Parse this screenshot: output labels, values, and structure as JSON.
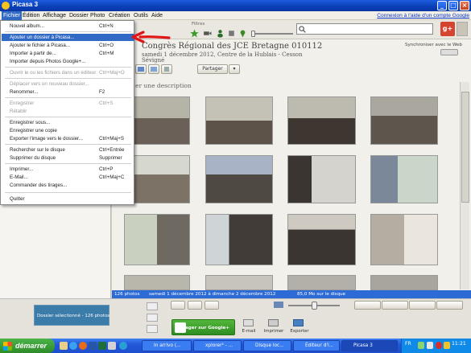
{
  "app": {
    "title": "Picasa 3"
  },
  "menubar": {
    "items": [
      "Fichier",
      "Édition",
      "Affichage",
      "Dossier",
      "Photo",
      "Création",
      "Outils",
      "Aide"
    ],
    "help_link": "Connexion à l'aide d'un compte Google"
  },
  "toolbar": {
    "filters_label": "Filtres",
    "search_value": ""
  },
  "file_menu": {
    "items": [
      {
        "label": "Nouvel album...",
        "shortcut": "Ctrl+N",
        "enabled": true
      },
      {
        "label": "Ajouter un dossier à Picasa...",
        "shortcut": "",
        "enabled": true,
        "highlighted": true
      },
      {
        "label": "Ajouter le fichier à Picasa...",
        "shortcut": "Ctrl+O",
        "enabled": true
      },
      {
        "label": "Importer à partir de...",
        "shortcut": "Ctrl+M",
        "enabled": true
      },
      {
        "label": "Importer depuis Photos Google+...",
        "shortcut": "",
        "enabled": true
      },
      {
        "label": "Ouvrir le ou les fichiers dans un éditeur",
        "shortcut": "Ctrl+Maj+O",
        "enabled": false
      },
      {
        "label": "Déplacer vers un nouveau dossier...",
        "shortcut": "",
        "enabled": false
      },
      {
        "label": "Renommer...",
        "shortcut": "F2",
        "enabled": true
      },
      {
        "label": "Enregistrer",
        "shortcut": "Ctrl+S",
        "enabled": false
      },
      {
        "label": "Rétablir",
        "shortcut": "",
        "enabled": false
      },
      {
        "label": "Enregistrer sous...",
        "shortcut": "",
        "enabled": true
      },
      {
        "label": "Enregistrer une copie",
        "shortcut": "",
        "enabled": true
      },
      {
        "label": "Exporter l'image vers le dossier...",
        "shortcut": "Ctrl+Maj+S",
        "enabled": true
      },
      {
        "label": "Rechercher sur le disque",
        "shortcut": "Ctrl+Entrée",
        "enabled": true
      },
      {
        "label": "Supprimer du disque",
        "shortcut": "Supprimer",
        "enabled": true
      },
      {
        "label": "Imprimer...",
        "shortcut": "Ctrl+P",
        "enabled": true
      },
      {
        "label": "E-Mail...",
        "shortcut": "Ctrl+Maj+C",
        "enabled": true
      },
      {
        "label": "Commander des tirages...",
        "shortcut": "",
        "enabled": true
      },
      {
        "label": "Quitter",
        "shortcut": "",
        "enabled": true
      }
    ]
  },
  "folder": {
    "title": "Congrès Régional des JCE Bretagne 010112",
    "date_line": "samedi 1 décembre 2012, Centre de la Hublais - Cesson",
    "place_line": "Sévigné",
    "share_button": "Partager",
    "description_prompt": "er une description",
    "sync_label": "Synchroniser avec le Web"
  },
  "status": {
    "count": "126 photos",
    "range": "samedi 1 décembre 2012 à dimanche 2 décembre 2012",
    "size": "85,0 Mo sur le disque"
  },
  "tray": {
    "selection": "Dossier sélectionné - 126 photos",
    "share_google": "Partager sur Google+",
    "email": "E-mail",
    "print": "Imprimer",
    "export": "Exporter"
  },
  "taskbar": {
    "start": "démarrer",
    "tasks": [
      "In arrivo (...",
      "xplorer² - ...",
      "Disque loc...",
      "Éditeur d'i...",
      "Picasa 3"
    ],
    "language": "FR",
    "clock": "11:21"
  },
  "colors": {
    "accent": "#316ac5",
    "title_bar": "#0a3fb8",
    "share_green": "#3aa12c",
    "status_blue": "#2c6ad6"
  }
}
